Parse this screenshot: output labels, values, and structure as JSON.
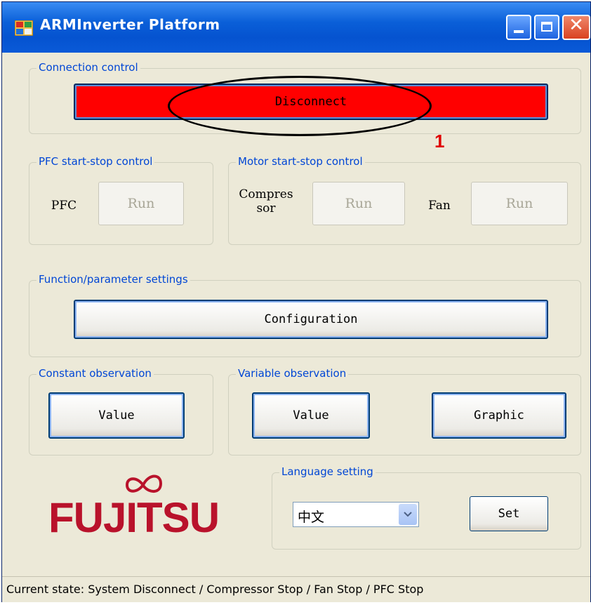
{
  "window": {
    "title": "ARMInverter Platform"
  },
  "connection": {
    "group_label": "Connection control",
    "disconnect_label": "Disconnect"
  },
  "annotation": {
    "number": "1"
  },
  "pfc": {
    "group_label": "PFC start-stop control",
    "label": "PFC",
    "run_label": "Run"
  },
  "motor": {
    "group_label": "Motor start-stop control",
    "compressor_label_line1": "Compres",
    "compressor_label_line2": "sor",
    "compressor_run_label": "Run",
    "fan_label": "Fan",
    "fan_run_label": "Run"
  },
  "function": {
    "group_label": "Function/parameter settings",
    "configuration_label": "Configuration"
  },
  "constant_obs": {
    "group_label": "Constant observation",
    "value_label": "Value"
  },
  "variable_obs": {
    "group_label": "Variable observation",
    "value_label": "Value",
    "graphic_label": "Graphic"
  },
  "language": {
    "group_label": "Language setting",
    "selected": "中文",
    "set_label": "Set"
  },
  "logo": {
    "text": "FUJITSU"
  },
  "status": {
    "text": "Current state: System Disconnect / Compressor Stop / Fan Stop / PFC Stop"
  },
  "colors": {
    "disconnect_bg": "#ff0000",
    "group_label": "#0046d5",
    "logo": "#b9122b",
    "annotation": "#e00000"
  }
}
